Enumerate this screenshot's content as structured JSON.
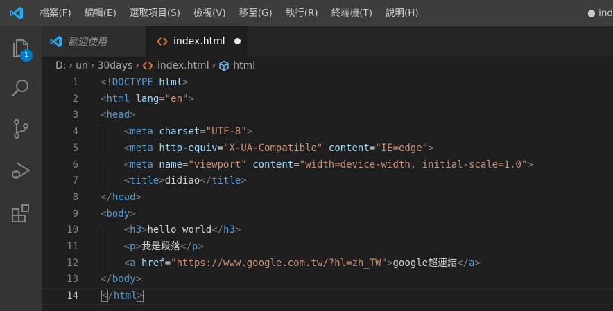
{
  "menu": [
    "檔案(F)",
    "編輯(E)",
    "選取項目(S)",
    "檢視(V)",
    "移至(G)",
    "執行(R)",
    "終端機(T)",
    "說明(H)"
  ],
  "window_title_fragment": "● ind",
  "activity": {
    "explorer_badge": "1"
  },
  "tabs": {
    "welcome": "歡迎使用",
    "active": "index.html"
  },
  "breadcrumb": {
    "drive": "D:",
    "folder1": "un",
    "folder2": "30days",
    "file": "index.html",
    "symbol": "html"
  },
  "editor": {
    "line_numbers": [
      "1",
      "2",
      "3",
      "4",
      "5",
      "6",
      "7",
      "8",
      "9",
      "10",
      "11",
      "12",
      "13",
      "14"
    ],
    "lines": [
      [
        [
          "b",
          "<!"
        ],
        [
          "t",
          "DOCTYPE "
        ],
        [
          "a",
          "html"
        ],
        [
          "b",
          ">"
        ]
      ],
      [
        [
          "b",
          "<"
        ],
        [
          "t",
          "html "
        ],
        [
          "a",
          "lang"
        ],
        [
          "x",
          "="
        ],
        [
          "s",
          "\"en\""
        ],
        [
          "b",
          ">"
        ]
      ],
      [
        [
          "b",
          "<"
        ],
        [
          "t",
          "head"
        ],
        [
          "b",
          ">"
        ]
      ],
      [
        [
          "x",
          "    "
        ],
        [
          "b",
          "<"
        ],
        [
          "t",
          "meta "
        ],
        [
          "a",
          "charset"
        ],
        [
          "x",
          "="
        ],
        [
          "s",
          "\"UTF-8\""
        ],
        [
          "b",
          ">"
        ]
      ],
      [
        [
          "x",
          "    "
        ],
        [
          "b",
          "<"
        ],
        [
          "t",
          "meta "
        ],
        [
          "a",
          "http-equiv"
        ],
        [
          "x",
          "="
        ],
        [
          "s",
          "\"X-UA-Compatible\""
        ],
        [
          "x",
          " "
        ],
        [
          "a",
          "content"
        ],
        [
          "x",
          "="
        ],
        [
          "s",
          "\"IE=edge\""
        ],
        [
          "b",
          ">"
        ]
      ],
      [
        [
          "x",
          "    "
        ],
        [
          "b",
          "<"
        ],
        [
          "t",
          "meta "
        ],
        [
          "a",
          "name"
        ],
        [
          "x",
          "="
        ],
        [
          "s",
          "\"viewport\""
        ],
        [
          "x",
          " "
        ],
        [
          "a",
          "content"
        ],
        [
          "x",
          "="
        ],
        [
          "s",
          "\"width=device-width, initial-scale=1.0\""
        ],
        [
          "b",
          ">"
        ]
      ],
      [
        [
          "x",
          "    "
        ],
        [
          "b",
          "<"
        ],
        [
          "t",
          "title"
        ],
        [
          "b",
          ">"
        ],
        [
          "x",
          "didiao"
        ],
        [
          "b",
          "</"
        ],
        [
          "t",
          "title"
        ],
        [
          "b",
          ">"
        ]
      ],
      [
        [
          "b",
          "</"
        ],
        [
          "t",
          "head"
        ],
        [
          "b",
          ">"
        ]
      ],
      [
        [
          "b",
          "<"
        ],
        [
          "t",
          "body"
        ],
        [
          "b",
          ">"
        ]
      ],
      [
        [
          "x",
          "    "
        ],
        [
          "b",
          "<"
        ],
        [
          "t",
          "h3"
        ],
        [
          "b",
          ">"
        ],
        [
          "x",
          "hello world"
        ],
        [
          "b",
          "</"
        ],
        [
          "t",
          "h3"
        ],
        [
          "b",
          ">"
        ]
      ],
      [
        [
          "x",
          "    "
        ],
        [
          "b",
          "<"
        ],
        [
          "t",
          "p"
        ],
        [
          "b",
          ">"
        ],
        [
          "x",
          "我是段落"
        ],
        [
          "b",
          "</"
        ],
        [
          "t",
          "p"
        ],
        [
          "b",
          ">"
        ]
      ],
      [
        [
          "x",
          "    "
        ],
        [
          "b",
          "<"
        ],
        [
          "t",
          "a "
        ],
        [
          "a",
          "href"
        ],
        [
          "x",
          "="
        ],
        [
          "s",
          "\""
        ],
        [
          "l",
          "https://www.google.com.tw/?hl=zh_TW"
        ],
        [
          "s",
          "\""
        ],
        [
          "b",
          ">"
        ],
        [
          "x",
          "google超連結"
        ],
        [
          "b",
          "</"
        ],
        [
          "t",
          "a"
        ],
        [
          "b",
          ">"
        ]
      ],
      [
        [
          "b",
          "</"
        ],
        [
          "t",
          "body"
        ],
        [
          "b",
          ">"
        ]
      ],
      [
        [
          "m",
          "<"
        ],
        [
          "b",
          "/"
        ],
        [
          "t",
          "html"
        ],
        [
          "m",
          ">"
        ]
      ]
    ],
    "active_line": 14
  },
  "colors": {
    "accent": "#007acc",
    "tag": "#569cd6",
    "attribute": "#9cdcfe",
    "string": "#ce9178",
    "bracket": "#808080",
    "text": "#d4d4d4"
  }
}
